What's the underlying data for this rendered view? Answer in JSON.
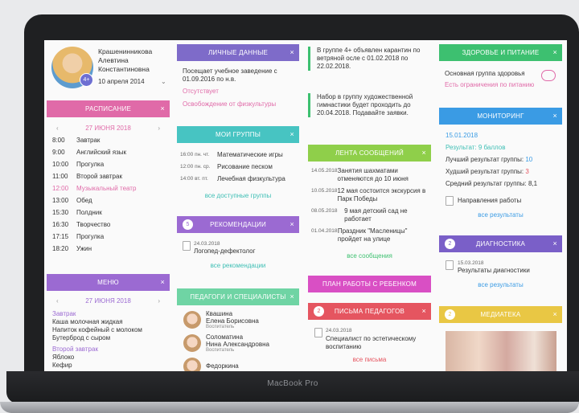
{
  "device": {
    "brand": "MacBook Pro"
  },
  "profile": {
    "name": "Крашенинникова Алевтина Константиновна",
    "date": "10 апреля 2014",
    "badge": "4+"
  },
  "schedule": {
    "title": "РАСПИСАНИЕ",
    "date": "27 ИЮНЯ 2018",
    "items": [
      {
        "time": "8:00",
        "label": "Завтрак"
      },
      {
        "time": "9:00",
        "label": "Английский язык"
      },
      {
        "time": "10:00",
        "label": "Прогулка"
      },
      {
        "time": "11:00",
        "label": "Второй завтрак"
      },
      {
        "time": "12:00",
        "label": "Музыкальный театр"
      },
      {
        "time": "13:00",
        "label": "Обед"
      },
      {
        "time": "15:30",
        "label": "Полдник"
      },
      {
        "time": "16:30",
        "label": "Творчество"
      },
      {
        "time": "17:15",
        "label": "Прогулка"
      },
      {
        "time": "18:20",
        "label": "Ужин"
      }
    ]
  },
  "menu": {
    "title": "МЕНЮ",
    "date": "27 ИЮНЯ 2018",
    "cat1": "Завтрак",
    "b1": "Каша молочная жидкая",
    "b2": "Напиток кофейный с молоком",
    "b3": "Бутерброд с сыром",
    "cat2": "Второй завтрак",
    "s1": "Яблоко",
    "s2": "Кефир"
  },
  "personal": {
    "title": "ЛИЧНЫЕ ДАННЫЕ",
    "text": "Посещает учебное заведение с 01.09.2016 по н.в.",
    "status": "Отсутствует",
    "exemption": "Освобождение от физкультуры"
  },
  "groups": {
    "title": "МОИ ГРУППЫ",
    "items": [
      {
        "time": "16:00 пн. чт.",
        "name": "Математические игры"
      },
      {
        "time": "12:00 пн. ср.",
        "name": "Рисование песком"
      },
      {
        "time": "14:00 вт. пт.",
        "name": "Лечебная физкультура"
      }
    ],
    "all": "все доступные группы"
  },
  "recommendations": {
    "title": "РЕКОМЕНДАЦИИ",
    "count": "5",
    "date": "24.03.2018",
    "text": "Логопед-дефектолог",
    "all": "все рекомендации"
  },
  "teachers": {
    "title": "ПЕДАГОГИ И СПЕЦИАЛИСТЫ",
    "items": [
      {
        "name1": "Квашина",
        "name2": "Елена Борисовна",
        "role": "Воспитатель"
      },
      {
        "name1": "Соломатина",
        "name2": "Нина Александровна",
        "role": "Воспитатель"
      },
      {
        "name1": "Федоркина",
        "name2": "",
        "role": ""
      }
    ]
  },
  "notices": {
    "n1": "В группе 4+ объявлен карантин по ветряной осле с 01.02.2018 по 22.02.2018.",
    "n2": "Набор в группу художественной гимнастики будет проходить до 20.04.2018. Подавайте заявки."
  },
  "feed": {
    "title": "ЛЕНТА СООБЩЕНИЙ",
    "items": [
      {
        "date": "14.05.2018",
        "text": "Занятия шахматами отменяются до 10 июня"
      },
      {
        "date": "10.05.2018",
        "text": "12 мая состоится экскурсия в Парк Победы"
      },
      {
        "date": "08.05.2018",
        "text": "9 мая детский сад не работает"
      },
      {
        "date": "01.04.2018",
        "text": "Праздник \"Масленицы\" пройдет на улице"
      }
    ],
    "all": "все сообщения"
  },
  "plan": {
    "title": "ПЛАН РАБОТЫ С РЕБЕНКОМ"
  },
  "letters": {
    "title": "ПИСЬМА ПЕДАГОГОВ",
    "count": "2",
    "date": "24.03.2018",
    "text": "Специалист по эстетическому воспитанию",
    "all": "все письма"
  },
  "health": {
    "title": "ЗДОРОВЬЕ И ПИТАНИЕ",
    "group": "Основная группа здоровья",
    "restriction": "Есть ограничения по питанию"
  },
  "monitoring": {
    "title": "МОНИТОРИНГ",
    "date": "15.01.2018",
    "result": "Результат: 9 баллов",
    "best_label": "Лучший результат группы:",
    "best": "10",
    "worst_label": "Худший результат группы:",
    "worst": "3",
    "avg": "Средний результат группы: 8,1",
    "directions": "Направления работы",
    "all": "все результаты"
  },
  "diagnostics": {
    "title": "ДИАГНОСТИКА",
    "count": "2",
    "date": "15.03.2018",
    "text": "Результаты диагностики",
    "all": "все результаты"
  },
  "media": {
    "title": "МЕДИАТЕКА",
    "count": "2"
  },
  "close": "×",
  "arrows": {
    "prev": "‹",
    "next": "›",
    "chev": "⌄"
  },
  "colors": {
    "violet": "#7e6bc9",
    "pink": "#e06aa8",
    "teal": "#47c4c2",
    "green": "#3dc070",
    "blue": "#3a9be4"
  }
}
